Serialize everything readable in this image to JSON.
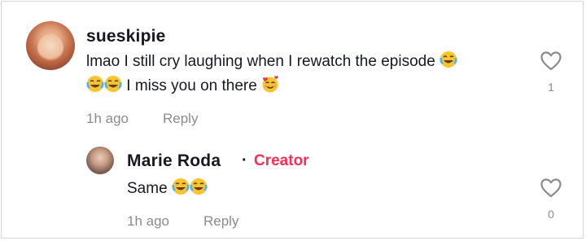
{
  "comments": [
    {
      "username": "sueskipie",
      "text_line1": "lmao I still cry laughing when I rewatch the episode",
      "text_line2": "I miss you on there",
      "time": "1h ago",
      "reply_label": "Reply",
      "like_count": "1",
      "emoji_line1": "face-with-tears-of-joy",
      "emoji_line2_start": [
        "face-with-tears-of-joy",
        "face-with-tears-of-joy"
      ],
      "emoji_line2_end": "smiling-face-with-hearts"
    },
    {
      "username": "Marie Roda",
      "separator": "·",
      "badge": "Creator",
      "text": "Same",
      "time": "1h ago",
      "reply_label": "Reply",
      "like_count": "0",
      "emoji": [
        "face-with-tears-of-joy",
        "face-with-tears-of-joy"
      ]
    }
  ],
  "colors": {
    "text": "#161823",
    "secondary": "#8a8b91",
    "creator": "#fe2c55",
    "border": "#d6d6d6"
  }
}
